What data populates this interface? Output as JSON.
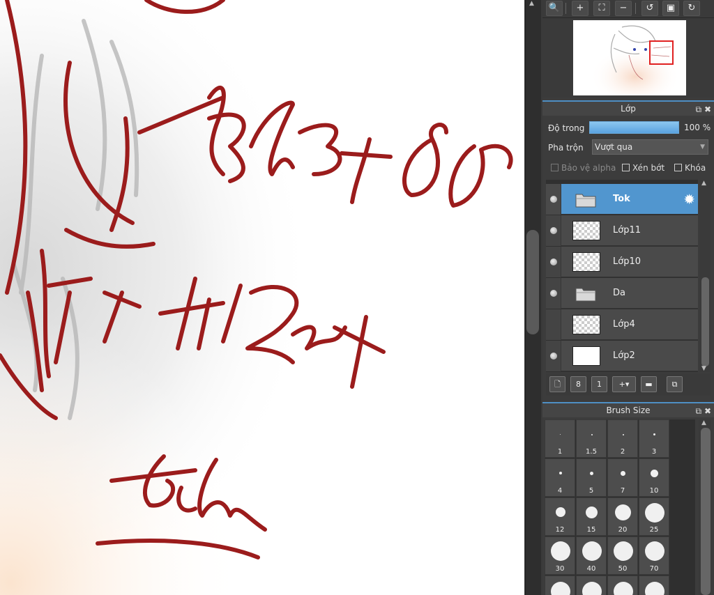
{
  "navigator": {
    "buttons": [
      "zoom-in-icon",
      "zoom-in-icon",
      "fit-icon",
      "zoom-out-icon",
      "rotate-left-icon",
      "actual-size-icon",
      "rotate-right-icon"
    ]
  },
  "layers_panel": {
    "title": "Lớp",
    "opacity_label": "Độ trong",
    "opacity_value": "100 %",
    "blend_label": "Pha trộn",
    "blend_value": "Vượt qua",
    "protect_alpha": "Bảo vệ alpha",
    "clipping": "Xén bớt",
    "lock": "Khóa",
    "layers": [
      {
        "name": "Tok",
        "type": "folder",
        "visible": true,
        "selected": true
      },
      {
        "name": "Lớp11",
        "type": "layer",
        "visible": true,
        "selected": false
      },
      {
        "name": "Lớp10",
        "type": "layer",
        "visible": true,
        "selected": false
      },
      {
        "name": "Da",
        "type": "folder",
        "visible": true,
        "selected": false
      },
      {
        "name": "Lớp4",
        "type": "layer",
        "visible": false,
        "selected": false
      },
      {
        "name": "Lớp2",
        "type": "layer",
        "visible": true,
        "selected": false
      }
    ]
  },
  "brush_panel": {
    "title": "Brush Size",
    "sizes": [
      "1",
      "1.5",
      "2",
      "3",
      "4",
      "5",
      "7",
      "10",
      "12",
      "15",
      "20",
      "25",
      "30",
      "40",
      "50",
      "70"
    ]
  },
  "colors": {
    "accent": "#5196cf",
    "stroke": "#9b1c1c"
  }
}
